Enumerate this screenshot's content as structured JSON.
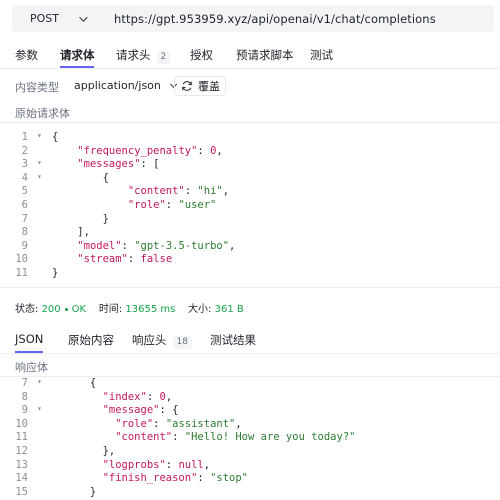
{
  "request": {
    "method": "POST",
    "url": "https://gpt.953959.xyz/api/openai/v1/chat/completions"
  },
  "request_tabs": [
    {
      "label": "参数"
    },
    {
      "label": "请求体",
      "active": true
    },
    {
      "label": "请求头",
      "badge": "2"
    },
    {
      "label": "授权"
    },
    {
      "label": "预请求脚本"
    },
    {
      "label": "测试"
    }
  ],
  "content_type": {
    "label": "内容类型",
    "value": "application/json",
    "format_label": "覆盖"
  },
  "raw_body_label": "原始请求体",
  "request_body_lines": [
    {
      "n": "1",
      "fold": true,
      "t": "{"
    },
    {
      "n": "2",
      "fold": false,
      "t": "    \"frequency_penalty\": 0,"
    },
    {
      "n": "3",
      "fold": true,
      "t": "    \"messages\": ["
    },
    {
      "n": "4",
      "fold": true,
      "t": "        {"
    },
    {
      "n": "5",
      "fold": false,
      "t": "            \"content\": \"hi\","
    },
    {
      "n": "6",
      "fold": false,
      "t": "            \"role\": \"user\""
    },
    {
      "n": "7",
      "fold": false,
      "t": "        }"
    },
    {
      "n": "8",
      "fold": false,
      "t": "    ],"
    },
    {
      "n": "9",
      "fold": false,
      "t": "    \"model\": \"gpt-3.5-turbo\","
    },
    {
      "n": "10",
      "fold": false,
      "t": "    \"stream\": false"
    },
    {
      "n": "11",
      "fold": false,
      "t": "}"
    }
  ],
  "status": {
    "status_label": "状态:",
    "status_value": "200 · OK",
    "time_label": "时间:",
    "time_value": "13655 ms",
    "size_label": "大小:",
    "size_value": "361 B"
  },
  "response_tabs": [
    {
      "label": "JSON",
      "active": true
    },
    {
      "label": "原始内容"
    },
    {
      "label": "响应头",
      "badge": "18"
    },
    {
      "label": "测试结果"
    }
  ],
  "response_body_label": "响应体",
  "response_body_lines": [
    {
      "n": "7",
      "fold": true,
      "t": "      {"
    },
    {
      "n": "8",
      "fold": false,
      "t": "        \"index\": 0,"
    },
    {
      "n": "9",
      "fold": true,
      "t": "        \"message\": {"
    },
    {
      "n": "10",
      "fold": false,
      "t": "          \"role\": \"assistant\","
    },
    {
      "n": "11",
      "fold": false,
      "t": "          \"content\": \"Hello! How are you today?\""
    },
    {
      "n": "12",
      "fold": false,
      "t": "        },"
    },
    {
      "n": "13",
      "fold": false,
      "t": "        \"logprobs\": null,"
    },
    {
      "n": "14",
      "fold": false,
      "t": "        \"finish_reason\": \"stop\""
    },
    {
      "n": "15",
      "fold": false,
      "t": "      }"
    }
  ],
  "colors": {
    "accent": "#6366f1",
    "json_key": "#c2185b",
    "json_string": "#2e7d32",
    "status_ok": "#16a34a"
  }
}
